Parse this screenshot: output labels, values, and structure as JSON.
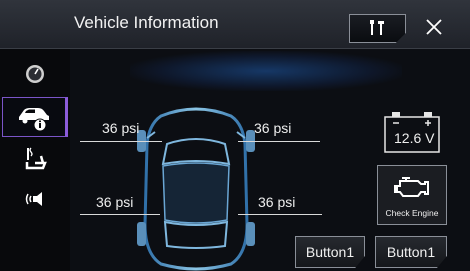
{
  "header": {
    "title": "Vehicle Information"
  },
  "tires": {
    "front_left": "36 psi",
    "front_right": "36 psi",
    "rear_left": "36 psi",
    "rear_right": "36 psi"
  },
  "battery": {
    "voltage": "12.6 V"
  },
  "engine": {
    "label": "Check Engine"
  },
  "buttons": {
    "left": "Button1",
    "right": "Button1"
  },
  "icons": {
    "tools": "tools-icon",
    "close": "close-icon",
    "gauge": "gauge-icon",
    "vehicle_info": "car-info-icon",
    "seat_heat": "seat-heat-icon",
    "sound": "sound-icon",
    "battery": "battery-icon",
    "engine": "engine-icon"
  },
  "colors": {
    "accent": "#8b5cd9",
    "background": "#0c0e13"
  }
}
